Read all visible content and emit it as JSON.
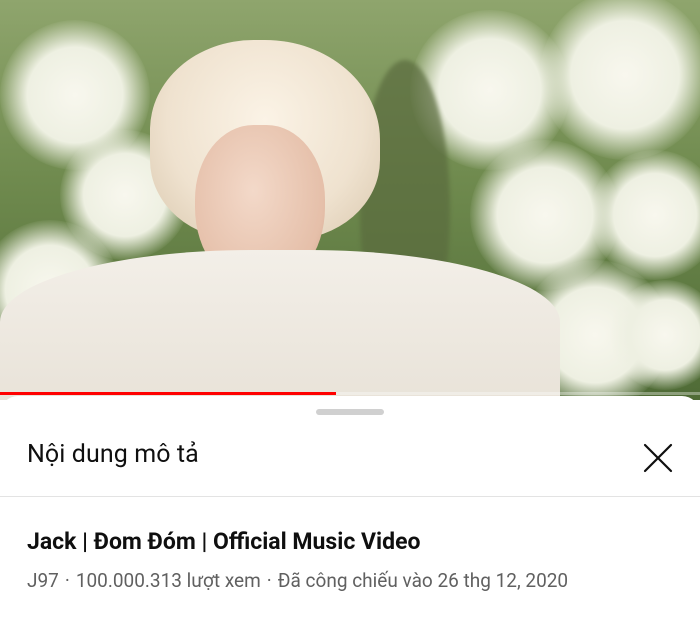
{
  "player": {
    "progress_fraction": 0.48,
    "progress_color": "#ff0000"
  },
  "sheet": {
    "title": "Nội dung mô tả",
    "close_icon": "close-icon"
  },
  "video": {
    "title": "Jack | Đom Đóm | Official Music Video",
    "channel": "J97",
    "views": "100.000.313 lượt xem",
    "premiered": "Đã công chiếu vào 26 thg 12, 2020",
    "separator": "·"
  }
}
